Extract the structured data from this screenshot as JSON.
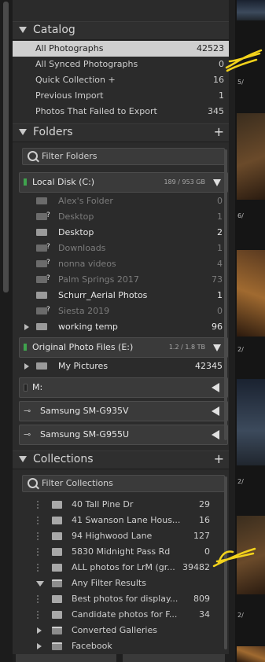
{
  "catalog": {
    "title": "Catalog",
    "items": [
      {
        "label": "All Photographs",
        "count": "42523"
      },
      {
        "label": "All Synced Photographs",
        "count": "0"
      },
      {
        "label": "Quick Collection  +",
        "count": "16"
      },
      {
        "label": "Previous Import",
        "count": "1"
      },
      {
        "label": "Photos That Failed to Export",
        "count": "345"
      }
    ]
  },
  "folders": {
    "title": "Folders",
    "add": "+",
    "filter_placeholder": "Filter Folders",
    "volumes": [
      {
        "name": "Local Disk (C:)",
        "size": "189 / 953 GB"
      },
      {
        "name": "Original Photo Files (E:)",
        "size": "1.2 / 1.8 TB"
      },
      {
        "name": "M:"
      },
      {
        "name": "Samsung SM-G935V"
      },
      {
        "name": "Samsung SM-G955U"
      }
    ],
    "c_folders": [
      {
        "label": "Alex's Folder",
        "count": "0"
      },
      {
        "label": "Desktop",
        "count": "1"
      },
      {
        "label": "Desktop",
        "count": "2"
      },
      {
        "label": "Downloads",
        "count": "1"
      },
      {
        "label": "nonna videos",
        "count": "4"
      },
      {
        "label": "Palm Springs 2017",
        "count": "73"
      },
      {
        "label": "Schurr_Aerial Photos",
        "count": "1"
      },
      {
        "label": "Siesta 2019",
        "count": "0"
      },
      {
        "label": "working temp",
        "count": "96"
      }
    ],
    "e_folders": [
      {
        "label": "My Pictures",
        "count": "42345"
      }
    ]
  },
  "collections": {
    "title": "Collections",
    "add": "+",
    "filter_placeholder": "Filter Collections",
    "items": [
      {
        "label": "40 Tall Pine Dr",
        "count": "29"
      },
      {
        "label": "41 Swanson Lane Hous...",
        "count": "16"
      },
      {
        "label": "94 Highwood Lane",
        "count": "127"
      },
      {
        "label": "5830 Midnight Pass Rd",
        "count": "0"
      },
      {
        "label": "ALL photos for LrM (gr...",
        "count": "39482"
      },
      {
        "label": "Any Filter Results",
        "count": ""
      },
      {
        "label": "Best photos for display...",
        "count": "809"
      },
      {
        "label": "Candidate photos for F...",
        "count": "34"
      },
      {
        "label": "Converted Galleries",
        "count": ""
      },
      {
        "label": "Facebook",
        "count": ""
      }
    ]
  },
  "filmstrip_labels": [
    "5/",
    "6/",
    "2/",
    "2/",
    "2/",
    "2/"
  ],
  "colors": {
    "selected_row": "#cfcfcf",
    "annotation": "#f2d21b",
    "volume_online": "#3fa34d"
  }
}
